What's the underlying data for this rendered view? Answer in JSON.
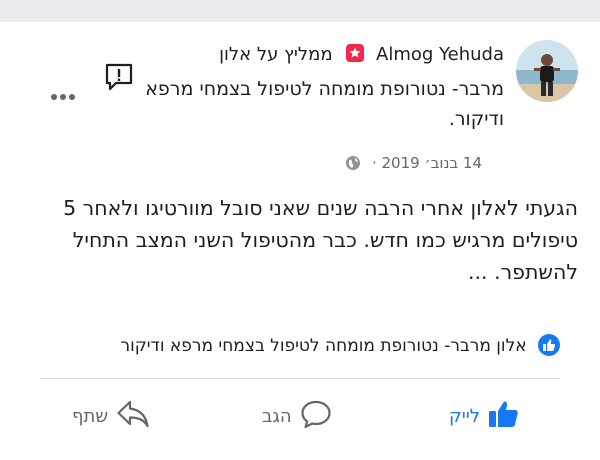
{
  "post": {
    "author": "Almog Yehuda",
    "recommends_text": "ממליץ על",
    "recommended": "אלון",
    "bio": "מרבר- נטורופת מומחה לטיפול בצמחי מרפא ודיקור.",
    "date": "14 בנוב׳ 2019",
    "separator": "·",
    "text": "הגעתי לאלון אחרי הרבה שנים שאני סובל מוורטיגו ולאחר 5 טיפולים מרגיש כמו חדש. כבר מהטיפול השני המצב התחיל להשתפר. ..."
  },
  "recommended_page": {
    "name": "אלון מרבר- נטורופת מומחה לטיפול בצמחי מרפא ודיקור"
  },
  "actions": {
    "like": "לייק",
    "comment": "הגב",
    "share": "שתף"
  },
  "icons": {
    "report": "report-icon",
    "more": "more-icon",
    "globe": "globe-icon",
    "recommend": "recommend-icon",
    "like_badge": "thumbs-up-icon"
  },
  "colors": {
    "accent": "#1877f2",
    "recommend_badge": "#f02849",
    "secondary_text": "#606770"
  }
}
